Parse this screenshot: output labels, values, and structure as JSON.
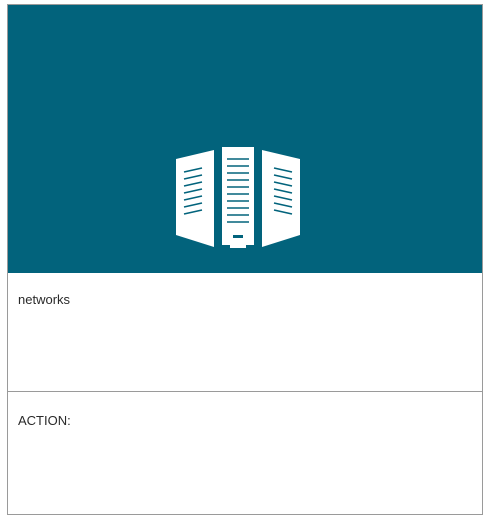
{
  "card": {
    "icon": "server-rack-icon",
    "accent_color": "#02637c",
    "category_label": "networks",
    "action_label": "ACTION:"
  }
}
